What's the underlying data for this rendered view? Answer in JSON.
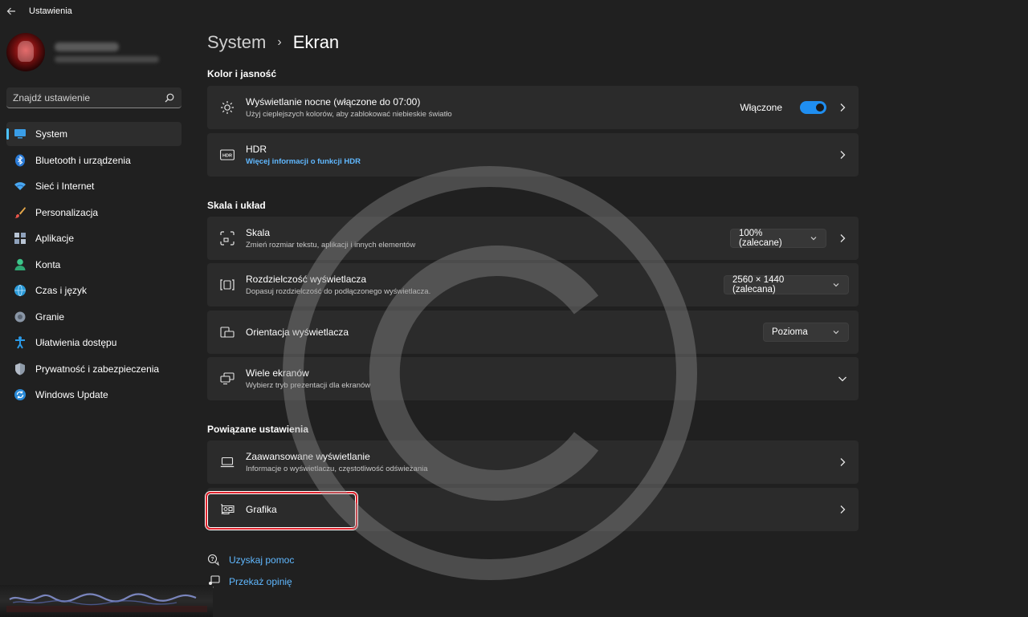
{
  "window": {
    "title": "Ustawienia"
  },
  "sidebar": {
    "search": {
      "value": "Znajdź ustawienie"
    },
    "items": [
      {
        "label": "System",
        "icon": "monitor-icon",
        "active": true
      },
      {
        "label": "Bluetooth i urządzenia",
        "icon": "bluetooth-icon"
      },
      {
        "label": "Sieć i Internet",
        "icon": "wifi-icon"
      },
      {
        "label": "Personalizacja",
        "icon": "brush-icon"
      },
      {
        "label": "Aplikacje",
        "icon": "apps-icon"
      },
      {
        "label": "Konta",
        "icon": "person-icon"
      },
      {
        "label": "Czas i język",
        "icon": "globe-clock-icon"
      },
      {
        "label": "Granie",
        "icon": "gamepad-icon"
      },
      {
        "label": "Ułatwienia dostępu",
        "icon": "accessibility-icon"
      },
      {
        "label": "Prywatność i zabezpieczenia",
        "icon": "shield-icon"
      },
      {
        "label": "Windows Update",
        "icon": "update-icon"
      }
    ]
  },
  "breadcrumb": {
    "parent": "System",
    "separator": "›",
    "current": "Ekran"
  },
  "sections": {
    "color": "Kolor i jasność",
    "scale": "Skala i układ",
    "related": "Powiązane ustawienia"
  },
  "cards": {
    "night_light": {
      "title": "Wyświetlanie nocne (włączone do 07:00)",
      "subtitle": "Użyj cieplejszych kolorów, aby zablokować niebieskie światło",
      "toggle_label": "Włączone",
      "toggle_on": true
    },
    "hdr": {
      "title": "HDR",
      "link": "Więcej informacji o funkcji HDR"
    },
    "scale": {
      "title": "Skala",
      "subtitle": "Zmień rozmiar tekstu, aplikacji i innych elementów",
      "value": "100% (zalecane)"
    },
    "resolution": {
      "title": "Rozdzielczość wyświetlacza",
      "subtitle": "Dopasuj rozdzielczość do podłączonego wyświetlacza.",
      "value": "2560 × 1440 (zalecana)"
    },
    "orientation": {
      "title": "Orientacja wyświetlacza",
      "value": "Pozioma"
    },
    "multi": {
      "title": "Wiele ekranów",
      "subtitle": "Wybierz tryb prezentacji dla ekranów"
    },
    "advanced": {
      "title": "Zaawansowane wyświetlanie",
      "subtitle": "Informacje o wyświetlaczu, częstotliwość odświeżania"
    },
    "graphics": {
      "title": "Grafika"
    }
  },
  "help": {
    "get_help": "Uzyskaj pomoc",
    "feedback": "Przekaż opinię"
  },
  "colors": {
    "accent": "#4cc2ff",
    "toggle_on": "#1f8ef0",
    "link": "#60b8ff",
    "highlight": "#e0242e"
  }
}
